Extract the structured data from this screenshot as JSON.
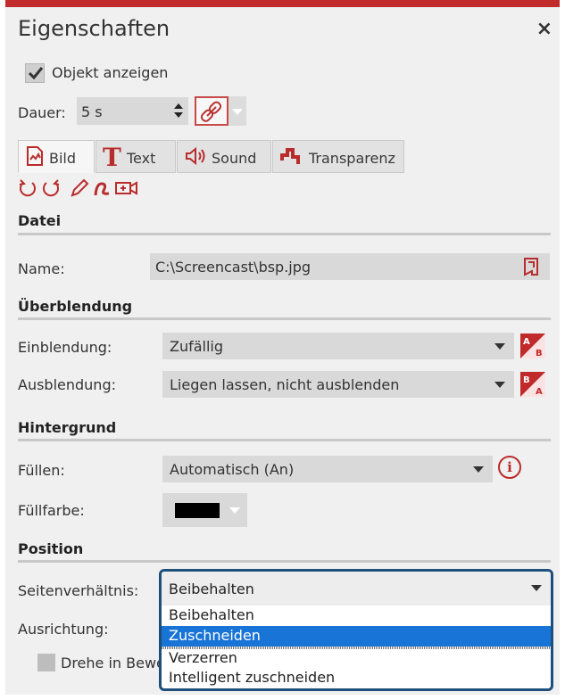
{
  "panel": {
    "title": "Eigenschaften",
    "close_glyph": "×",
    "accent_color": "#c22b2b"
  },
  "show_object": {
    "label": "Objekt anzeigen",
    "checked": true
  },
  "duration": {
    "label": "Dauer:",
    "value": "5 s",
    "link_icon": "link-icon"
  },
  "tabs": [
    {
      "label": "Bild",
      "icon": "image-icon",
      "active": true
    },
    {
      "label": "Text",
      "icon": "text-icon",
      "active": false
    },
    {
      "label": "Sound",
      "icon": "speaker-icon",
      "active": false
    },
    {
      "label": "Transparenz",
      "icon": "transparency-icon",
      "active": false
    }
  ],
  "toolbar": {
    "icons": [
      "rotate-left-icon",
      "rotate-right-icon",
      "pencil-icon",
      "curve-icon",
      "camera-icon"
    ]
  },
  "sections": {
    "datei": {
      "title": "Datei",
      "name_label": "Name:",
      "name_value": "C:\\Screencast\\bsp.jpg"
    },
    "ueberblendung": {
      "title": "Überblendung",
      "in_label": "Einblendung:",
      "in_value": "Zufällig",
      "out_label": "Ausblendung:",
      "out_value": "Liegen lassen, nicht ausblenden"
    },
    "hintergrund": {
      "title": "Hintergrund",
      "fill_label": "Füllen:",
      "fill_value": "Automatisch (An)",
      "color_label": "Füllfarbe:",
      "color_value": "#000000"
    },
    "position": {
      "title": "Position",
      "aspect_label": "Seitenverhältnis:",
      "aspect_value": "Beibehalten",
      "align_label": "Ausrichtung:",
      "rotate_label": "Drehe in Bewe",
      "options": [
        "Beibehalten",
        "Zuschneiden",
        "Verzerren",
        "Intelligent zuschneiden"
      ],
      "highlighted_option": "Zuschneiden"
    }
  }
}
